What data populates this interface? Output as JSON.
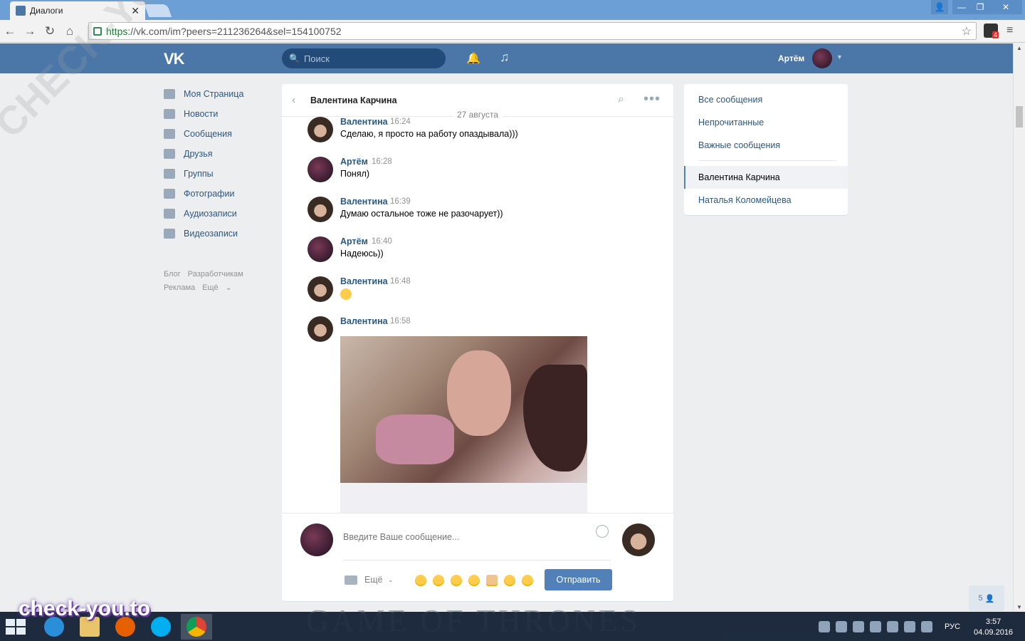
{
  "browser": {
    "tab_title": "Диалоги",
    "url_scheme": "https",
    "url_rest": "://vk.com/im?peers=211236264&sel=154100752",
    "ext_badge": "4"
  },
  "header": {
    "search_placeholder": "Поиск",
    "user_name": "Артём"
  },
  "left_menu": {
    "items": [
      {
        "label": "Моя Страница",
        "icon": "home-icon"
      },
      {
        "label": "Новости",
        "icon": "news-icon"
      },
      {
        "label": "Сообщения",
        "icon": "messages-icon"
      },
      {
        "label": "Друзья",
        "icon": "friends-icon"
      },
      {
        "label": "Группы",
        "icon": "groups-icon"
      },
      {
        "label": "Фотографии",
        "icon": "camera-icon"
      },
      {
        "label": "Аудиозаписи",
        "icon": "music-icon"
      },
      {
        "label": "Видеозаписи",
        "icon": "video-icon"
      }
    ],
    "footer": [
      "Блог",
      "Разработчикам",
      "Реклама",
      "Ещё"
    ]
  },
  "dialog": {
    "title": "Валентина Карчина",
    "date_separator": "27 августа",
    "messages": [
      {
        "author": "Валентина",
        "time": "16:24",
        "text": "Сделаю, я просто на работу опаздывала)))"
      },
      {
        "author": "Артём",
        "time": "16:28",
        "text": "Понял)"
      },
      {
        "author": "Валентина",
        "time": "16:39",
        "text": "Думаю остальное тоже не разочарует))"
      },
      {
        "author": "Артём",
        "time": "16:40",
        "text": "Надеюсь))"
      },
      {
        "author": "Валентина",
        "time": "16:48",
        "text": ""
      },
      {
        "author": "Валентина",
        "time": "16:58",
        "text": ""
      }
    ],
    "composer": {
      "placeholder": "Введите Ваше сообщение...",
      "more_label": "Ещё",
      "send_label": "Отправить"
    }
  },
  "right_panel": {
    "filters": [
      "Все сообщения",
      "Непрочитанные",
      "Важные сообщения"
    ],
    "conversations": [
      "Валентина Карчина",
      "Наталья Коломейцева"
    ]
  },
  "online_counter": "5",
  "taskbar": {
    "lang": "РУС",
    "time": "3:57",
    "date": "04.09.2016"
  },
  "watermark": {
    "big": "check-you.to",
    "diag": "CHECK-YOU.ME"
  },
  "desktop_text": "GAME OF THRONES",
  "colors": {
    "vk_blue": "#4a76a8",
    "link": "#2a5885",
    "send_button": "#5181b8",
    "page_bg": "#edeef0"
  }
}
